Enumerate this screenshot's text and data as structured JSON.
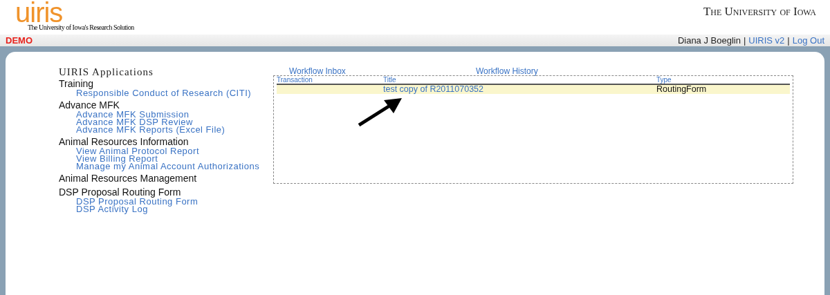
{
  "header": {
    "logo": "uiris",
    "tagline": "The University of Iowa's Research Solution",
    "university": "The University of Iowa"
  },
  "bar": {
    "environment": "DEMO",
    "user": "Diana J Boeglin",
    "separator": "|",
    "links": [
      "UIRIS v2",
      "Log Out"
    ]
  },
  "sidebar": {
    "title": "UIRIS Applications",
    "sections": [
      {
        "heading": "Training",
        "children": [
          "Responsible Conduct of Research (CITI)"
        ]
      },
      {
        "heading": "Advance MFK",
        "children": [
          "Advance MFK Submission",
          "Advance MFK DSP Review",
          "Advance MFK Reports (Excel File)"
        ]
      },
      {
        "heading": "Animal Resources Information",
        "children": [
          "View Animal Protocol Report",
          "View Billing Report",
          "Manage my Animal Account Authorizations"
        ]
      },
      {
        "heading": "Animal Resources Management"
      },
      {
        "heading": "DSP Proposal Routing Form",
        "children": [
          "DSP Proposal Routing Form",
          "DSP Activity Log"
        ]
      }
    ]
  },
  "tabs": [
    "Workflow Inbox",
    "Workflow History"
  ],
  "table": {
    "columns": [
      "Transaction",
      "Title",
      "Type"
    ],
    "rows": [
      {
        "selected": true,
        "title": "test copy of R2011070352",
        "type": "RoutingForm"
      }
    ]
  }
}
